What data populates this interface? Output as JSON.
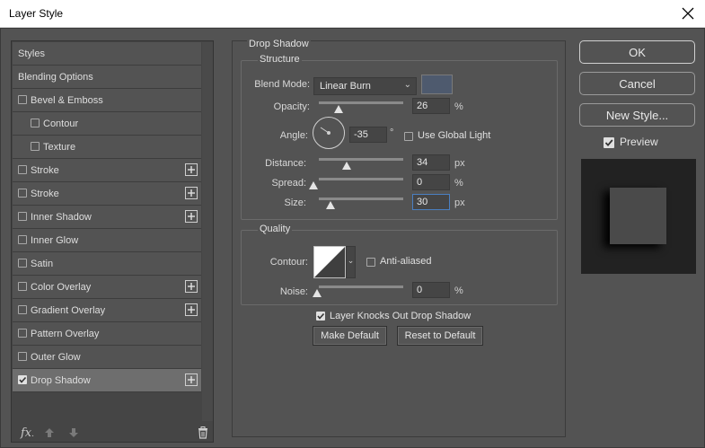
{
  "window": {
    "title": "Layer Style"
  },
  "style_list": {
    "items": [
      {
        "label": "Styles",
        "checkbox": false,
        "checked": false,
        "indent": false,
        "plus": false,
        "selected": false
      },
      {
        "label": "Blending Options",
        "checkbox": false,
        "checked": false,
        "indent": false,
        "plus": false,
        "selected": false
      },
      {
        "label": "Bevel & Emboss",
        "checkbox": true,
        "checked": false,
        "indent": false,
        "plus": false,
        "selected": false
      },
      {
        "label": "Contour",
        "checkbox": true,
        "checked": false,
        "indent": true,
        "plus": false,
        "selected": false
      },
      {
        "label": "Texture",
        "checkbox": true,
        "checked": false,
        "indent": true,
        "plus": false,
        "selected": false
      },
      {
        "label": "Stroke",
        "checkbox": true,
        "checked": false,
        "indent": false,
        "plus": true,
        "selected": false
      },
      {
        "label": "Stroke",
        "checkbox": true,
        "checked": false,
        "indent": false,
        "plus": true,
        "selected": false
      },
      {
        "label": "Inner Shadow",
        "checkbox": true,
        "checked": false,
        "indent": false,
        "plus": true,
        "selected": false
      },
      {
        "label": "Inner Glow",
        "checkbox": true,
        "checked": false,
        "indent": false,
        "plus": false,
        "selected": false
      },
      {
        "label": "Satin",
        "checkbox": true,
        "checked": false,
        "indent": false,
        "plus": false,
        "selected": false
      },
      {
        "label": "Color Overlay",
        "checkbox": true,
        "checked": false,
        "indent": false,
        "plus": true,
        "selected": false
      },
      {
        "label": "Gradient Overlay",
        "checkbox": true,
        "checked": false,
        "indent": false,
        "plus": true,
        "selected": false
      },
      {
        "label": "Pattern Overlay",
        "checkbox": true,
        "checked": false,
        "indent": false,
        "plus": false,
        "selected": false
      },
      {
        "label": "Outer Glow",
        "checkbox": true,
        "checked": false,
        "indent": false,
        "plus": false,
        "selected": false
      },
      {
        "label": "Drop Shadow",
        "checkbox": true,
        "checked": true,
        "indent": false,
        "plus": true,
        "selected": true
      }
    ],
    "footer": {
      "fx_label": "fx",
      "fx_dot": "."
    }
  },
  "drop_shadow": {
    "section_title": "Drop Shadow",
    "structure": {
      "title": "Structure",
      "blend_mode_label": "Blend Mode:",
      "blend_mode_value": "Linear Burn",
      "shadow_color": "#4e5a6e",
      "opacity_label": "Opacity:",
      "opacity_value": "26",
      "opacity_unit": "%",
      "opacity_level": 0.26,
      "angle_label": "Angle:",
      "angle_value": "-35",
      "angle_unit": "°",
      "use_global_light_label": "Use Global Light",
      "use_global_light_checked": false,
      "distance_label": "Distance:",
      "distance_value": "34",
      "distance_unit": "px",
      "spread_label": "Spread:",
      "spread_value": "0",
      "spread_unit": "%",
      "size_label": "Size:",
      "size_value": "30",
      "size_unit": "px"
    },
    "quality": {
      "title": "Quality",
      "contour_label": "Contour:",
      "anti_aliased_label": "Anti-aliased",
      "anti_aliased_checked": false,
      "noise_label": "Noise:",
      "noise_value": "0",
      "noise_unit": "%"
    },
    "knockout_label": "Layer Knocks Out Drop Shadow",
    "knockout_checked": true,
    "make_default_label": "Make Default",
    "reset_default_label": "Reset to Default"
  },
  "actions": {
    "ok_label": "OK",
    "cancel_label": "Cancel",
    "new_style_label": "New Style...",
    "preview_label": "Preview",
    "preview_checked": true
  }
}
